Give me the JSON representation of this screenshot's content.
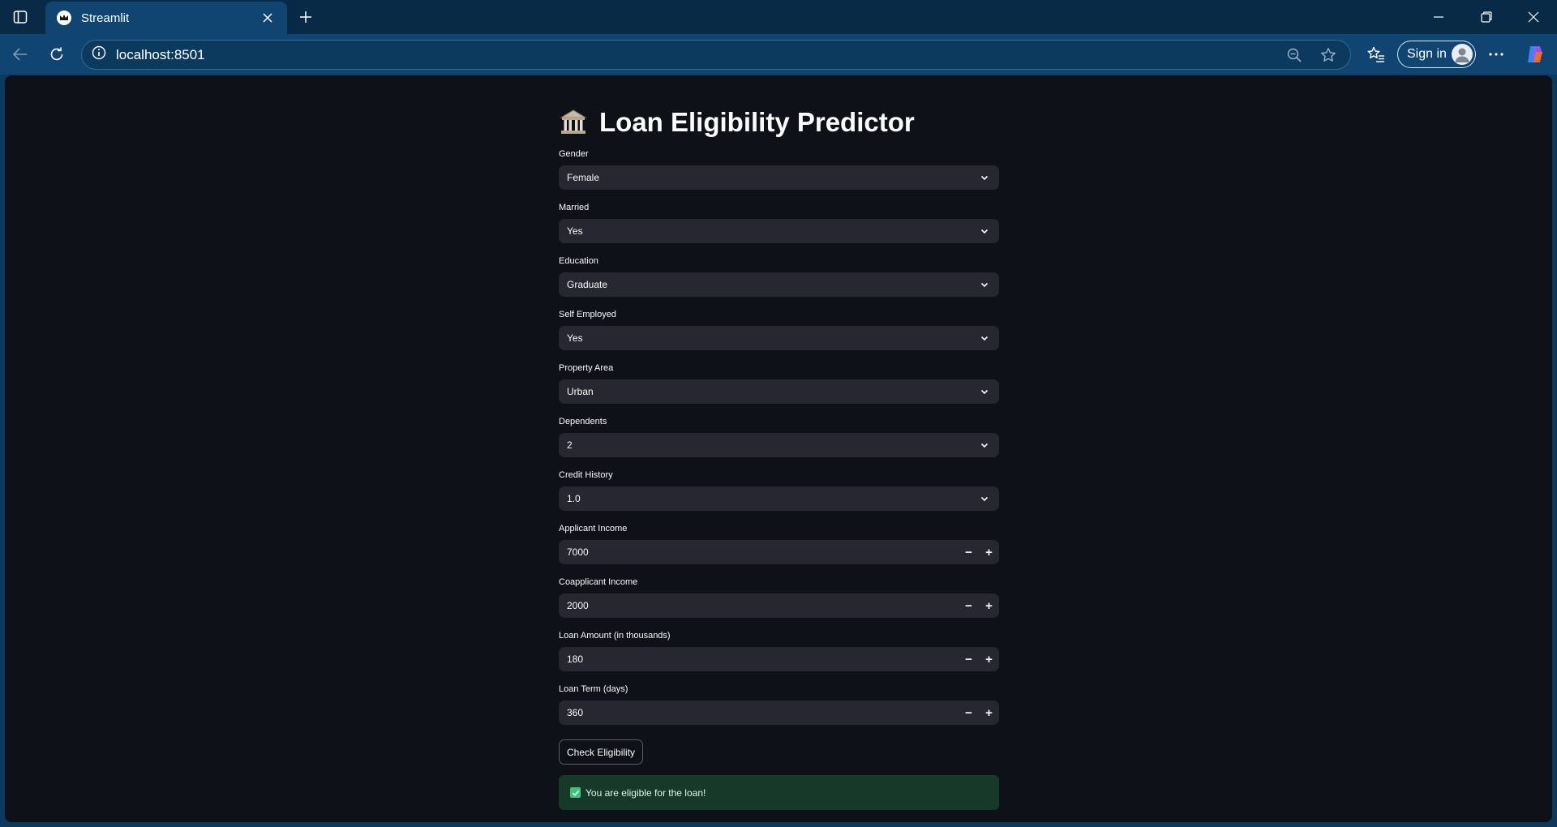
{
  "browser": {
    "tab_title": "Streamlit",
    "url": "localhost:8501",
    "sign_in_label": "Sign in",
    "icons": [
      "sidebar-toggle-icon",
      "streamlit-crown-icon",
      "close-icon",
      "plus-icon",
      "minimize-icon",
      "restore-icon",
      "back-arrow-icon",
      "refresh-icon",
      "info-icon",
      "zoom-out-icon",
      "star-icon",
      "favorites-icon",
      "profile-icon",
      "more-icon",
      "copilot-icon"
    ]
  },
  "app": {
    "title_emoji": "bank-building-icon",
    "title": "Loan Eligibility Predictor",
    "fields": {
      "gender": {
        "label": "Gender",
        "value": "Female"
      },
      "married": {
        "label": "Married",
        "value": "Yes"
      },
      "education": {
        "label": "Education",
        "value": "Graduate"
      },
      "self_employed": {
        "label": "Self Employed",
        "value": "Yes"
      },
      "property_area": {
        "label": "Property Area",
        "value": "Urban"
      },
      "dependents": {
        "label": "Dependents",
        "value": "2"
      },
      "credit_history": {
        "label": "Credit History",
        "value": "1.0"
      },
      "applicant_income": {
        "label": "Applicant Income",
        "value": "7000"
      },
      "coapplicant_income": {
        "label": "Coapplicant Income",
        "value": "2000"
      },
      "loan_amount": {
        "label": "Loan Amount (in thousands)",
        "value": "180"
      },
      "loan_term": {
        "label": "Loan Term (days)",
        "value": "360"
      }
    },
    "stepper": {
      "minus": "−",
      "plus": "+"
    },
    "button_label": "Check Eligibility",
    "result": {
      "icon": "check-box-icon",
      "text": "You are eligible for the loan!"
    }
  },
  "colors": {
    "page_bg": "#0e1117",
    "widget_bg": "#262730",
    "success_bg": "#173928",
    "success_icon": "#3ec47d",
    "browser_frame": "#0f4570"
  }
}
